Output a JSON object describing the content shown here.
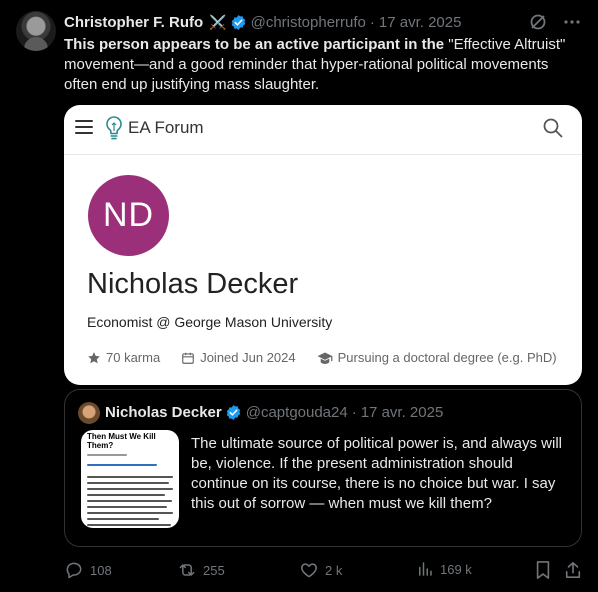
{
  "tweet": {
    "author_name": "Christopher F. Rufo",
    "author_emoji": "⚔️",
    "handle": "@christopherrufo",
    "date": "17 avr. 2025",
    "text_bold": "This person appears to be an active participant in the",
    "text_quoted": " \"Effective Altruist\"",
    "text_rest": " movement—and a good reminder that hyper-rational political movements often end up justifying mass slaughter."
  },
  "card": {
    "site_title": "EA Forum",
    "initials": "ND",
    "initials_bg": "#9b2f7a",
    "name": "Nicholas Decker",
    "bio": "Economist @ George Mason University",
    "stats": {
      "karma": "70 karma",
      "joined": "Joined Jun 2024",
      "status": "Pursuing a doctoral degree (e.g. PhD)"
    }
  },
  "quote": {
    "author_name": "Nicholas Decker",
    "handle": "@captgouda24",
    "date": "17 avr. 2025",
    "thumb_title": "Then Must We Kill Them?",
    "text": "The ultimate source of political power is, and always will be, violence. If the present administration should continue on its course, there is no choice but war. I say this out of sorrow —  when must we kill them?"
  },
  "actions": {
    "replies": "108",
    "reposts": "255",
    "likes": "2 k",
    "views": "169 k"
  },
  "colors": {
    "background": "#000000",
    "verified": "#1d9bf0",
    "muted": "#71767b"
  }
}
